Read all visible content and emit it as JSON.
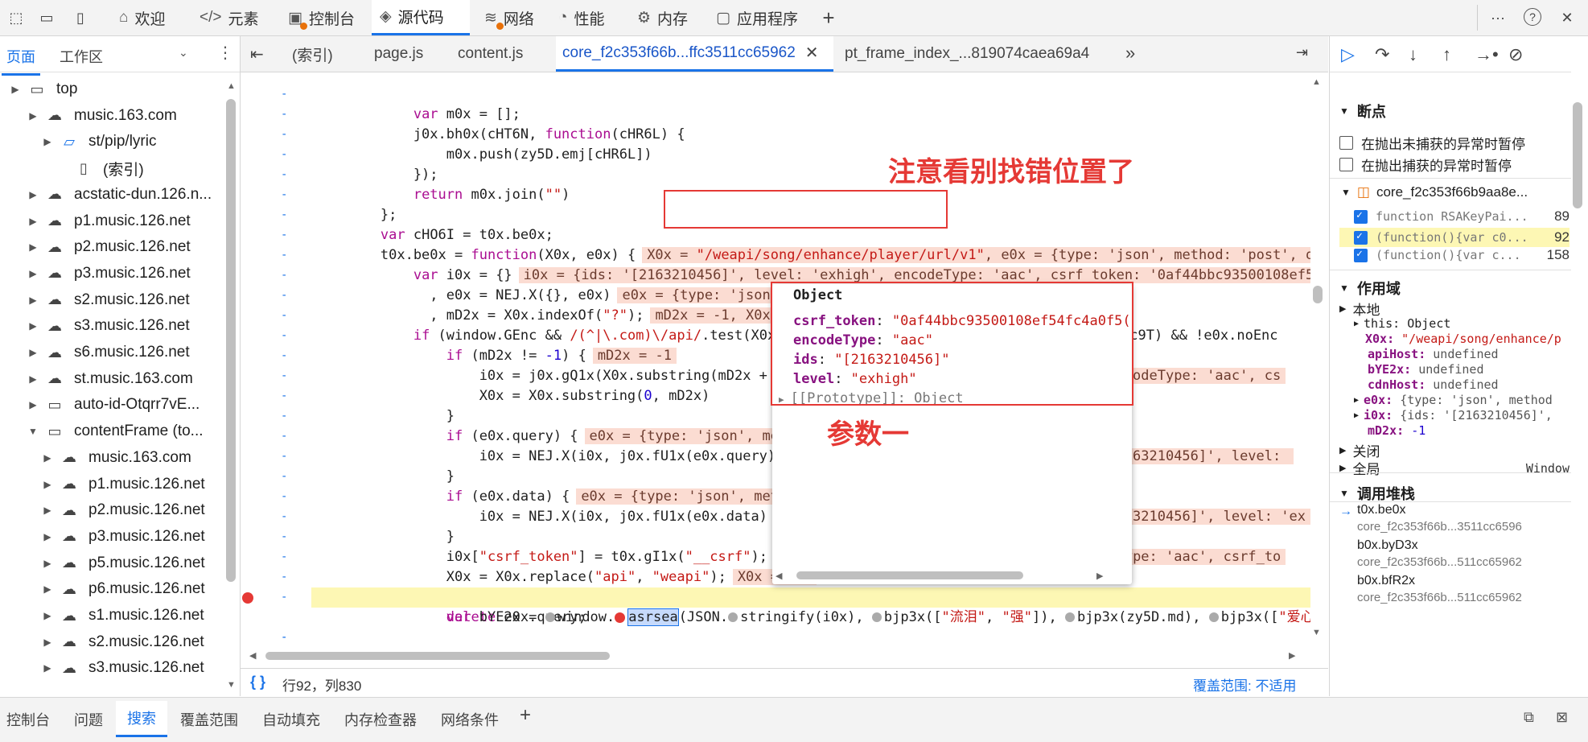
{
  "toolbar": {
    "tabs": [
      {
        "label": "欢迎",
        "icon": "home-icon"
      },
      {
        "label": "元素",
        "icon": "code-brackets-icon"
      },
      {
        "label": "控制台",
        "icon": "console-icon"
      },
      {
        "label": "源代码",
        "icon": "sources-icon"
      },
      {
        "label": "网络",
        "icon": "wifi-icon"
      },
      {
        "label": "性能",
        "icon": "performance-icon"
      },
      {
        "label": "内存",
        "icon": "memory-icon"
      },
      {
        "label": "应用程序",
        "icon": "application-icon"
      }
    ],
    "add": "+",
    "more": "···",
    "help": "?",
    "close": "✕"
  },
  "navigator": {
    "tabs": [
      "页面",
      "工作区"
    ],
    "tree": [
      {
        "label": "top",
        "icon": "frame-icon"
      },
      {
        "label": "music.163.com",
        "icon": "cloud-icon"
      },
      {
        "label": "st/pip/lyric",
        "icon": "folder-icon"
      },
      {
        "label": "(索引)",
        "icon": "file-icon"
      },
      {
        "label": "acstatic-dun.126.n...",
        "icon": "cloud-icon"
      },
      {
        "label": "p1.music.126.net",
        "icon": "cloud-icon"
      },
      {
        "label": "p2.music.126.net",
        "icon": "cloud-icon"
      },
      {
        "label": "p3.music.126.net",
        "icon": "cloud-icon"
      },
      {
        "label": "s2.music.126.net",
        "icon": "cloud-icon"
      },
      {
        "label": "s3.music.126.net",
        "icon": "cloud-icon"
      },
      {
        "label": "s6.music.126.net",
        "icon": "cloud-icon"
      },
      {
        "label": "st.music.163.com",
        "icon": "cloud-icon"
      },
      {
        "label": "auto-id-Otqrr7vE...",
        "icon": "frame-icon"
      },
      {
        "label": "contentFrame (to...",
        "icon": "frame-icon"
      },
      {
        "label": "music.163.com",
        "icon": "cloud-icon"
      },
      {
        "label": "p1.music.126.net",
        "icon": "cloud-icon"
      },
      {
        "label": "p2.music.126.net",
        "icon": "cloud-icon"
      },
      {
        "label": "p3.music.126.net",
        "icon": "cloud-icon"
      },
      {
        "label": "p5.music.126.net",
        "icon": "cloud-icon"
      },
      {
        "label": "p6.music.126.net",
        "icon": "cloud-icon"
      },
      {
        "label": "s1.music.126.net",
        "icon": "cloud-icon"
      },
      {
        "label": "s2.music.126.net",
        "icon": "cloud-icon"
      },
      {
        "label": "s3.music.126.net",
        "icon": "cloud-icon"
      }
    ]
  },
  "editor": {
    "tabs": [
      "(索引)",
      "page.js",
      "content.js",
      "core_f2c353f66b...ffc3511cc65962",
      "pt_frame_index_...819074caea69a4"
    ],
    "line_marker": "-",
    "status_position": "行92，列830",
    "coverage": "覆盖范围: 不适用",
    "format_btn": "{ }"
  },
  "popover": {
    "title": "Object",
    "fields": [
      {
        "key": "csrf_token",
        "value": "\"0af44bbc93500108ef54fc4a0f5("
      },
      {
        "key": "encodeType",
        "value": "\"aac\""
      },
      {
        "key": "ids",
        "value": "\"[2163210456]\""
      },
      {
        "key": "level",
        "value": "\"exhigh\""
      }
    ],
    "proto": "[[Prototype]]: Object"
  },
  "annotations": {
    "top": "注意看别找错位置了",
    "param": "参数一"
  },
  "debugger": {
    "breakpoints_title": "断点",
    "pause_uncaught": "在抛出未捕获的异常时暂停",
    "pause_caught": "在抛出捕获的异常时暂停",
    "bp_file": "core_f2c353f66b9aa8e...",
    "bp_items": [
      {
        "code": "function RSAKeyPai...",
        "line": "89"
      },
      {
        "code": "(function(){var c0...",
        "line": "92"
      },
      {
        "code": "(function(){var c...",
        "line": "158"
      }
    ],
    "scope_title": "作用域",
    "local": "本地",
    "scope_items": [
      {
        "k": "this:",
        "v": "Object"
      },
      {
        "k": "X0x:",
        "v": "\"/weapi/song/enhance/p"
      },
      {
        "k": "apiHost:",
        "v": "undefined"
      },
      {
        "k": "bYE2x:",
        "v": "undefined"
      },
      {
        "k": "cdnHost:",
        "v": "undefined"
      },
      {
        "k": "e0x:",
        "v": "{type: 'json', method"
      },
      {
        "k": "i0x:",
        "v": "{ids: '[2163210456]',"
      },
      {
        "k": "mD2x:",
        "v": "-1"
      }
    ],
    "closure": "关闭",
    "global": "全局",
    "global_val": "Window",
    "callstack_title": "调用堆栈",
    "frames": [
      {
        "fn": "t0x.be0x",
        "file": "core_f2c353f66b...3511cc6596"
      },
      {
        "fn": "b0x.byD3x",
        "file": "core_f2c353f66b...511cc65962"
      },
      {
        "fn": "b0x.bfR2x",
        "file": "core_f2c353f66b...511cc65962"
      }
    ]
  },
  "drawer": {
    "tabs": [
      "控制台",
      "问题",
      "搜索",
      "覆盖范围",
      "自动填充",
      "内存检查器",
      "网络条件"
    ],
    "add": "+"
  },
  "colors": {
    "accent": "#1a73e8",
    "annotation": "#e53935",
    "inline": "#fbdcd2",
    "highlight": "#fdf7b4"
  }
}
